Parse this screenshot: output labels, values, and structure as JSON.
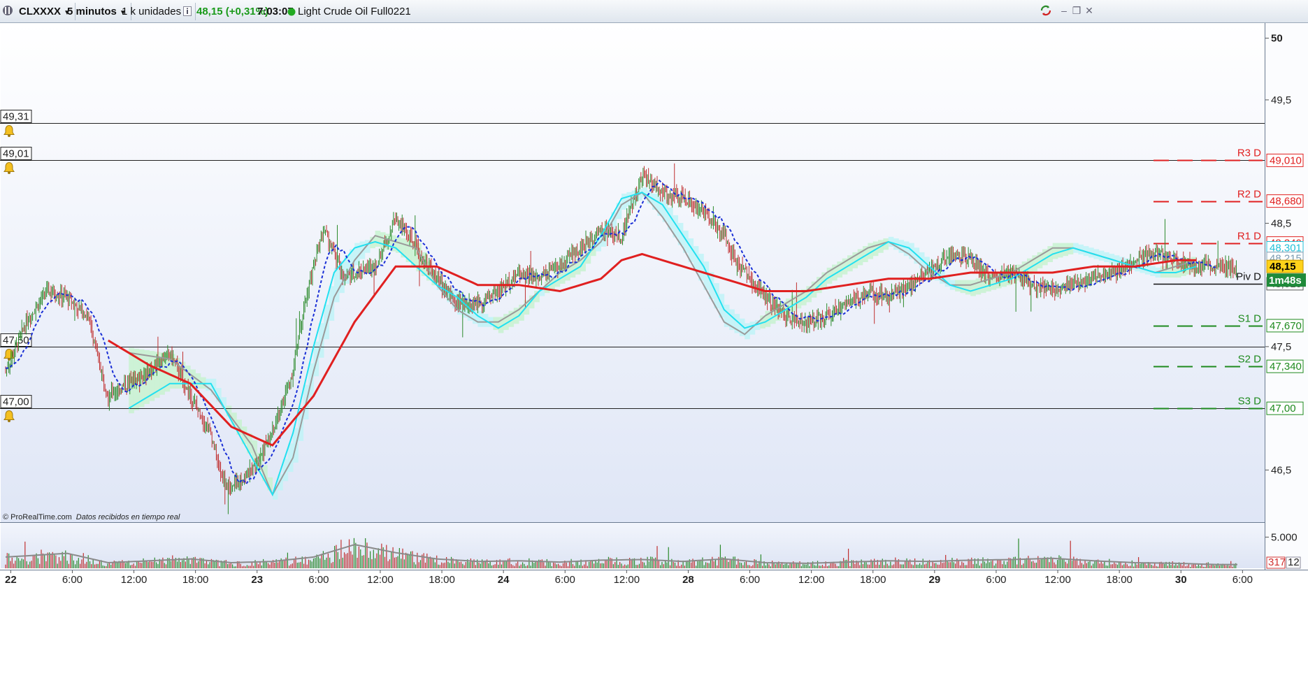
{
  "toolbar": {
    "app_icon": "proreal-logo-icon",
    "ticker": "CLXXXX",
    "timeframe": "5 minutos",
    "units": "1 k unidades",
    "info_icon": "info-icon",
    "price_change": "48,15 (+0,31%)",
    "time": "7:03:07",
    "status_color": "#22aa22",
    "instrument": "Light Crude Oil Full0221",
    "window_icons": [
      "refresh-icon",
      "minimize-icon",
      "restore-icon",
      "close-icon"
    ]
  },
  "footer_text": {
    "brand": "© ProRealTime.com",
    "note": "Datos recibidos en tiempo real"
  },
  "colors": {
    "ma_red": "#e02020",
    "dotted_blue": "#1a2fd6",
    "cyan": "#22e0f0",
    "gray": "#9a9a9a",
    "resistance": "#e02020",
    "support": "#1e8a1e",
    "candle_up": "#2b8a2b",
    "candle_down": "#c03030"
  },
  "chart_data": {
    "type": "line",
    "title": "",
    "xlabel": "",
    "ylabel": "",
    "ylim": [
      46.1,
      50.1
    ],
    "y_ticks": [
      {
        "value": 50,
        "label": "50"
      },
      {
        "value": 49.5,
        "label": "49,5"
      },
      {
        "value": 48.5,
        "label": "48,5"
      },
      {
        "value": 47.5,
        "label": "47,5"
      },
      {
        "value": 46.5,
        "label": "46,5"
      }
    ],
    "x_ticks": [
      "22",
      "6:00",
      "12:00",
      "18:00",
      "23",
      "6:00",
      "12:00",
      "18:00",
      "24",
      "6:00",
      "12:00",
      "28",
      "6:00",
      "12:00",
      "18:00",
      "29",
      "6:00",
      "12:00",
      "18:00",
      "30",
      "6:00"
    ],
    "alert_lines": [
      {
        "value": 49.31,
        "label": "49,31"
      },
      {
        "value": 49.01,
        "label": "49,01"
      },
      {
        "value": 47.5,
        "label": "47,50"
      },
      {
        "value": 47.0,
        "label": "47,00"
      }
    ],
    "pivots": [
      {
        "name": "R3 D",
        "value": 49.01,
        "label": "49,010",
        "kind": "resistance"
      },
      {
        "name": "R2 D",
        "value": 48.68,
        "label": "48,680",
        "kind": "resistance"
      },
      {
        "name": "R1 D",
        "value": 48.34,
        "label": "48,340",
        "kind": "resistance"
      },
      {
        "name": "Piv D",
        "value": 48.01,
        "label": "48,010",
        "kind": "pivot"
      },
      {
        "name": "S1 D",
        "value": 47.67,
        "label": "47,670",
        "kind": "support"
      },
      {
        "name": "S2 D",
        "value": 47.34,
        "label": "47,340",
        "kind": "support"
      },
      {
        "name": "S3 D",
        "value": 47.0,
        "label": "47,00",
        "kind": "support"
      }
    ],
    "indicator_labels": [
      {
        "value": 48.301,
        "label": "48,301",
        "color": "#22c0d8"
      },
      {
        "value": 48.215,
        "label": "48,215",
        "color": "#7a9ab0"
      }
    ],
    "last_price": {
      "value": 48.15,
      "label": "48,15"
    },
    "countdown": "1m48s",
    "series": [
      {
        "key": "price",
        "x": [
          0,
          2,
          4,
          6,
          8,
          9,
          10,
          12,
          14,
          16,
          18,
          20,
          21,
          22,
          24,
          26,
          28,
          29,
          30,
          31,
          32,
          33,
          34,
          36,
          37,
          38,
          40,
          42,
          44,
          46,
          48,
          50,
          52,
          54,
          56,
          58,
          60,
          62,
          64,
          66,
          68,
          70,
          71,
          72,
          74,
          76,
          78,
          80,
          82,
          84,
          86,
          88,
          90,
          92,
          94,
          96,
          98,
          100,
          102,
          104,
          106,
          108,
          110,
          112,
          114,
          116,
          118,
          120
        ],
        "y": [
          47.3,
          47.7,
          47.95,
          47.9,
          47.75,
          47.4,
          47.1,
          47.2,
          47.3,
          47.45,
          47.1,
          46.8,
          46.45,
          46.35,
          46.5,
          46.8,
          47.3,
          47.8,
          48.15,
          48.45,
          48.25,
          48.05,
          48.1,
          48.15,
          48.35,
          48.55,
          48.3,
          48.05,
          47.85,
          47.85,
          47.95,
          48.1,
          48.05,
          48.15,
          48.3,
          48.45,
          48.4,
          48.9,
          48.75,
          48.7,
          48.6,
          48.4,
          48.2,
          48.1,
          47.9,
          47.75,
          47.7,
          47.75,
          47.85,
          47.95,
          47.9,
          48.0,
          48.1,
          48.25,
          48.2,
          48.05,
          48.1,
          48.0,
          47.95,
          48.0,
          48.05,
          48.1,
          48.2,
          48.25,
          48.2,
          48.15,
          48.15,
          48.15
        ]
      },
      {
        "key": "ma_red",
        "x": [
          10,
          14,
          18,
          22,
          26,
          30,
          34,
          38,
          42,
          46,
          50,
          54,
          58,
          60,
          62,
          66,
          70,
          74,
          78,
          82,
          86,
          90,
          94,
          98,
          102,
          106,
          110,
          114,
          116
        ],
        "y": [
          47.55,
          47.35,
          47.2,
          46.85,
          46.7,
          47.1,
          47.7,
          48.15,
          48.15,
          48.0,
          48.0,
          47.95,
          48.05,
          48.2,
          48.25,
          48.15,
          48.05,
          47.95,
          47.95,
          48.0,
          48.05,
          48.05,
          48.1,
          48.1,
          48.1,
          48.15,
          48.15,
          48.2,
          48.2
        ]
      },
      {
        "key": "cyan",
        "x": [
          12,
          16,
          20,
          24,
          26,
          28,
          30,
          32,
          34,
          36,
          38,
          40,
          42,
          44,
          46,
          48,
          50,
          52,
          54,
          56,
          58,
          60,
          62,
          64,
          66,
          68,
          70,
          72,
          74,
          76,
          78,
          80,
          82,
          84,
          86,
          88,
          90,
          92,
          94,
          96,
          98,
          100,
          102,
          104,
          106,
          108,
          110,
          112,
          114,
          116
        ],
        "y": [
          47.0,
          47.2,
          47.2,
          46.6,
          46.3,
          46.8,
          47.5,
          48.1,
          48.3,
          48.35,
          48.3,
          48.15,
          48.0,
          47.9,
          47.75,
          47.65,
          47.75,
          47.95,
          48.05,
          48.15,
          48.4,
          48.7,
          48.75,
          48.65,
          48.4,
          48.15,
          47.8,
          47.65,
          47.7,
          47.8,
          47.9,
          48.05,
          48.15,
          48.25,
          48.35,
          48.3,
          48.15,
          48.0,
          47.95,
          48.0,
          48.05,
          48.15,
          48.25,
          48.3,
          48.25,
          48.2,
          48.15,
          48.1,
          48.1,
          48.15
        ]
      },
      {
        "key": "gray",
        "x": [
          12,
          16,
          20,
          24,
          26,
          28,
          30,
          32,
          34,
          36,
          38,
          40,
          42,
          44,
          46,
          48,
          50,
          52,
          54,
          56,
          58,
          60,
          62,
          64,
          66,
          68,
          70,
          72,
          74,
          76,
          78,
          80,
          82,
          84,
          86,
          88,
          90,
          92,
          94,
          96,
          98,
          100,
          102,
          104,
          106,
          108,
          110,
          112,
          114,
          116
        ],
        "y": [
          47.45,
          47.4,
          47.15,
          46.7,
          46.3,
          46.6,
          47.3,
          47.9,
          48.2,
          48.4,
          48.35,
          48.3,
          48.0,
          47.8,
          47.7,
          47.7,
          47.8,
          47.95,
          48.1,
          48.2,
          48.35,
          48.65,
          48.75,
          48.55,
          48.3,
          48.0,
          47.7,
          47.6,
          47.75,
          47.85,
          47.95,
          48.1,
          48.2,
          48.3,
          48.35,
          48.25,
          48.1,
          48.0,
          48.0,
          48.05,
          48.1,
          48.2,
          48.3,
          48.3,
          48.25,
          48.2,
          48.15,
          48.1,
          48.15,
          48.2
        ]
      },
      {
        "key": "volume_avg",
        "x": [
          0,
          6,
          10,
          14,
          18,
          22,
          26,
          30,
          34,
          38,
          42,
          46,
          50,
          54,
          58,
          62,
          66,
          70,
          74,
          78,
          82,
          86,
          90,
          94,
          98,
          102,
          106,
          110,
          114,
          118,
          120
        ],
        "y": [
          1800,
          2400,
          900,
          1200,
          1500,
          900,
          1100,
          1800,
          3800,
          2500,
          1500,
          1100,
          1200,
          1000,
          1300,
          1400,
          1100,
          1500,
          900,
          800,
          1000,
          1200,
          1100,
          1300,
          1400,
          1600,
          1200,
          900,
          800,
          600,
          600
        ]
      }
    ],
    "volume_ticks": [
      {
        "value": 5000,
        "label": "5.000"
      }
    ],
    "volume_last": {
      "value": 317,
      "label": "317"
    },
    "volume_scale_box": "12"
  }
}
